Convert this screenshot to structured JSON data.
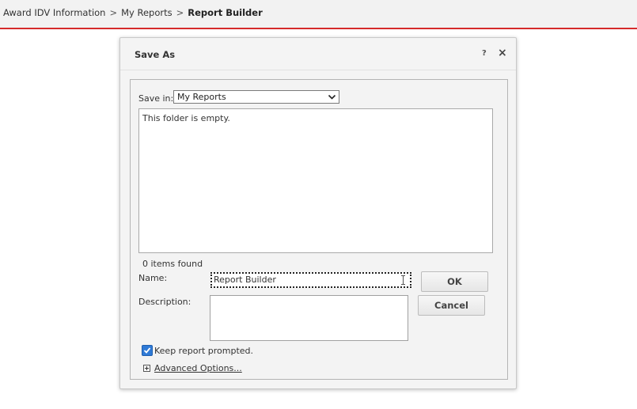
{
  "breadcrumb": {
    "items": [
      "Award IDV Information",
      "My Reports",
      "Report Builder"
    ],
    "separator": ">"
  },
  "dialog": {
    "title": "Save As",
    "help_label": "?",
    "close_label": "×",
    "save_in": {
      "label": "Save in:",
      "value": "My Reports"
    },
    "file_list": {
      "empty_message": "This folder is empty."
    },
    "items_found": "0 items found",
    "name": {
      "label": "Name:",
      "value": "Report Builder"
    },
    "description": {
      "label": "Description:",
      "value": ""
    },
    "buttons": {
      "ok": "OK",
      "cancel": "Cancel"
    },
    "keep_prompted": {
      "label": "Keep report prompted.",
      "checked": true
    },
    "advanced_options": "Advanced Options..."
  },
  "colors": {
    "accent_red": "#d52b2b",
    "checkbox_blue": "#2f7ad6"
  }
}
